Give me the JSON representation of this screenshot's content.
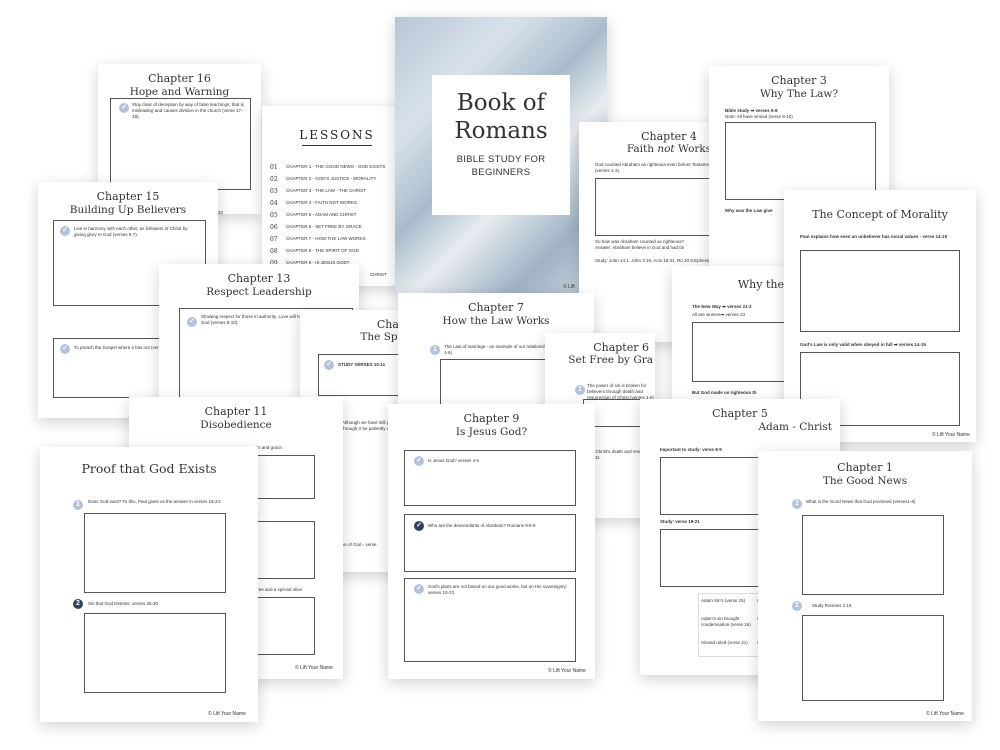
{
  "brand": "Lift Your Name",
  "cover": {
    "title_line1": "Book of",
    "title_line2": "Romans",
    "subtitle_line1": "BIBLE STUDY FOR",
    "subtitle_line2": "BEGINNERS",
    "brand_short": "Lift"
  },
  "lessons": {
    "title": "LESSONS",
    "items": [
      {
        "num": "01",
        "label": "CHAPTER 1 - THE GOOD NEWS - GOD EXISTS"
      },
      {
        "num": "02",
        "label": "CHAPTER 2 - GOD'S JUSTICE - MORALITY"
      },
      {
        "num": "03",
        "label": "CHAPTER 3 - THE LAW - THE CHRIST"
      },
      {
        "num": "04",
        "label": "CHAPTER 4 - FAITH NOT WORKS"
      },
      {
        "num": "05",
        "label": "CHAPTER 5 - ADAM AND CHRIST"
      },
      {
        "num": "06",
        "label": "CHAPTER 6 - SET FREE BY GRACE"
      },
      {
        "num": "07",
        "label": "CHAPTER 7 - HOW THE LAW WORKS"
      },
      {
        "num": "08",
        "label": "CHAPTER 8 - THE SPIRIT OF GOD"
      },
      {
        "num": "09",
        "label": "CHAPTER 9 - IS JESUS GOD?"
      }
    ],
    "partial": "CHRIST"
  },
  "ch16": {
    "t1": "Chapter 16",
    "t2": "Hope and Warning",
    "q1": "Stay clear of deception by way of false teachings, that is misleading and causes division in the church (verse 17-18).",
    "partial": "20"
  },
  "ch15": {
    "t1": "Chapter 15",
    "t2": "Building Up Believers",
    "q1": "Live in harmony with each other, as followers of Christ by giving glory to God (verses 5-7).",
    "q2": "To preach the Gospel where it has not (verse 20-21)."
  },
  "ch13": {
    "t1": "Chapter 13",
    "t2": "Respect Leadership",
    "q1": "Showing respect for those in authority. Love will help you fulfill most of God (verses 8-10)."
  },
  "ch8": {
    "t1": "Chap",
    "t2": "The Spir",
    "q1": "STUDY VERSES 10-11",
    "p1": "Although we have still go through tr be patiently awa",
    "p2": "ve of God - verse"
  },
  "ch7": {
    "t1": "Chapter 7",
    "t2": "How the Law Works",
    "q1": "The Law of marriage - an example of our relationship to Christ (verses 1-6)"
  },
  "ch6": {
    "t1": "Chapter 6",
    "t2": "Set Free by Gra",
    "q1": "The power of sin is broken for believers through death and resurrection of Christ (verses 1-5)",
    "p1": "w Christ's death and resurrection 5-11"
  },
  "ch4": {
    "t1": "Chapter 4",
    "t2a": "Faith ",
    "t2b": "not",
    "t2c": " Works",
    "q1": "God counted Abraham as righteous even before Testament Law was given (verses 1-3).",
    "q2": "So how was Abraham counted as righteous?",
    "q2b": "Answer: Abraham believe in God and had fai",
    "q3": "Study: John 14:1, John 3:16, Acts 16:31, Ro 10:9,Ephesians 2:8-10"
  },
  "ch3": {
    "t1": "Chapter 3",
    "t2": "Why The Law?",
    "q1": "Bible study ➡ verses 5-8",
    "q1b": "Note: All have sinned (verse 9-10)",
    "q2": "Why was the Law give"
  },
  "ch3b": {
    "t1": "Why the",
    "q1": "The New Way ➡ verses 21-2",
    "q1b": "All are sinners➡ verses 23",
    "q2": "But God made us righteous th"
  },
  "morality": {
    "title": "The Concept of Morality",
    "q1": "Paul explains how even an unbeliever has moral values - verse 14-15",
    "q2": "God's Law is only valid when obeyed in full ➡ verses 14-15"
  },
  "ch11": {
    "t1": "Chapter 11",
    "t2": "Disobedience",
    "p1": "ss and grace.",
    "p2": "s.",
    "p3": "tree and a special olive"
  },
  "ch9": {
    "t1": "Chapter 9",
    "t2": "Is Jesus God?",
    "q1": "Is Jesus God? verses 4-5",
    "q2": "Who are the descendants of Abraham? Romans 9:6-8",
    "q3": "God's plans are not based on our good works, but on His sovereignty: verses 10-23"
  },
  "ch5": {
    "t1": "Chapter 5",
    "t2": "Adam - Christ",
    "q1": "Important to study: verse 8-9",
    "q2": "Study: verse 19-21",
    "table": [
      [
        "Adam Sin's (verse 15)",
        "Gos"
      ],
      [
        "Adam's sin brought condemnation (verse 16)",
        "God abun"
      ],
      [
        "Sinned ruled (verse 21)",
        "Grac"
      ]
    ]
  },
  "proof": {
    "title": "Proof that God Exists",
    "q1": "Does God exist? To this, Paul gives us the answer in verses 18-24:",
    "q2": "Sin that God Detests: verses 25-30"
  },
  "ch1": {
    "t1": "Chapter 1",
    "t2": "The Good News",
    "q1": "What is the Good News that God promised (verses1-6)",
    "q2": "Study Romans 1:16"
  }
}
